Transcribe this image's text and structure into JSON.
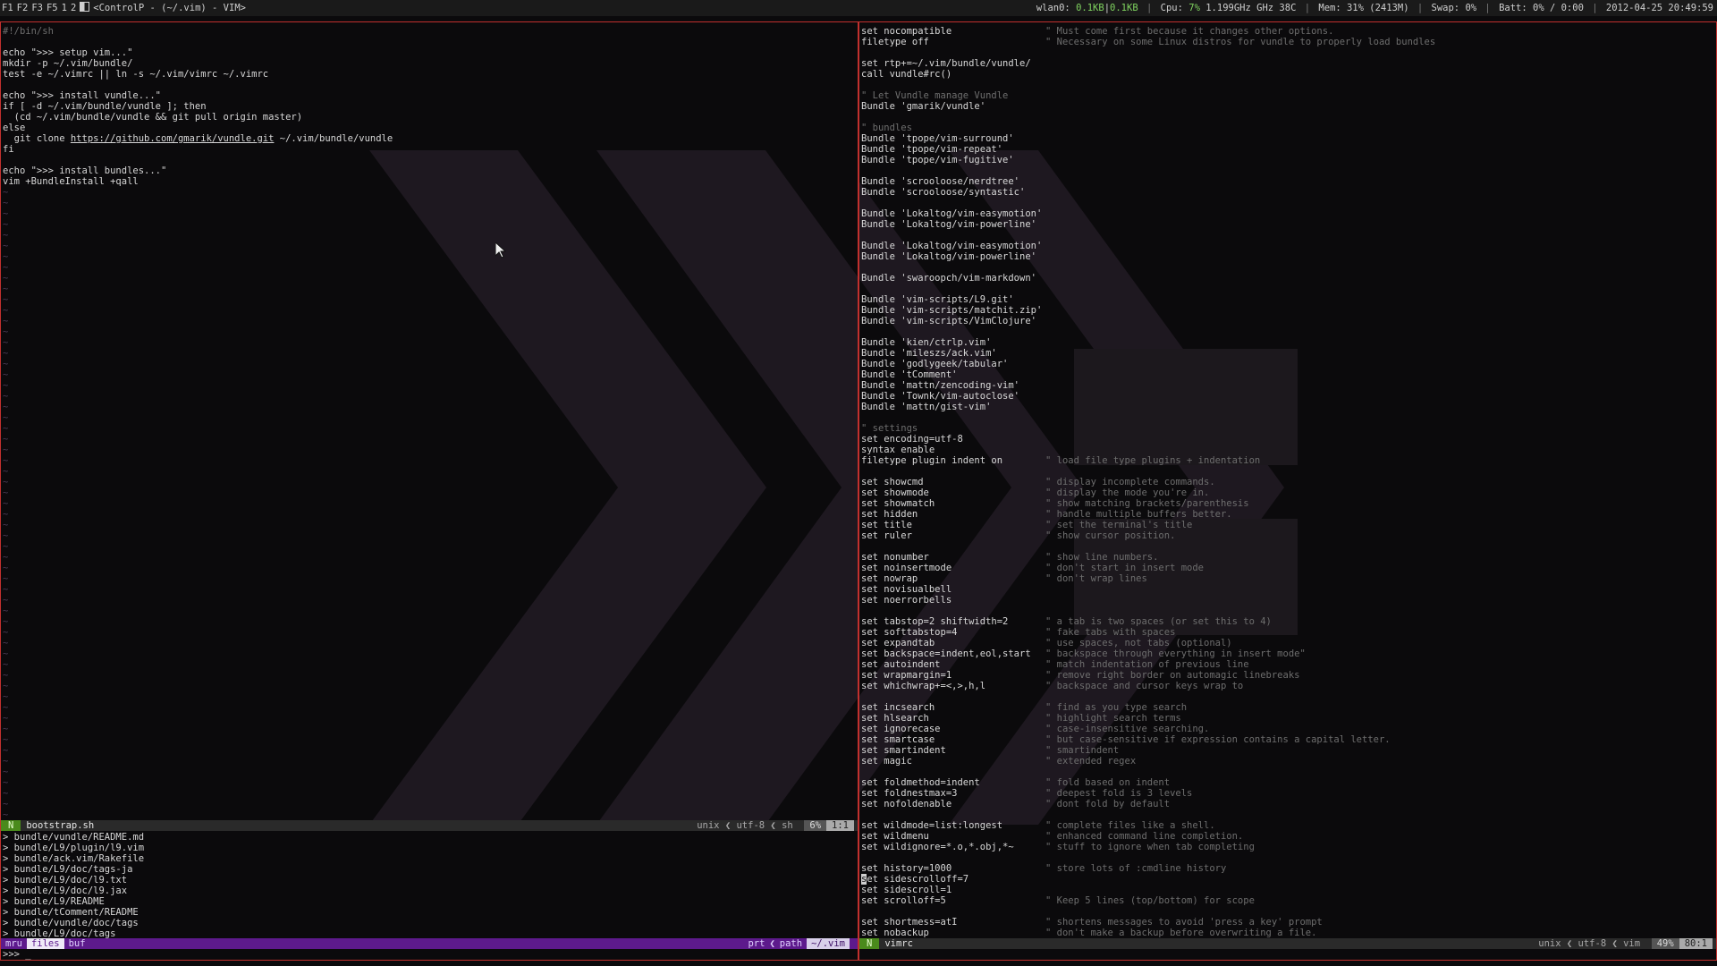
{
  "topbar": {
    "tags": [
      "F1",
      "F2",
      "F3",
      "F5",
      "1",
      "2"
    ],
    "window_title": "<ControlP - (~/.vim) - VIM>",
    "net_label": "wlan0:",
    "net_down": "0.1KB",
    "net_sep": "|",
    "net_up": "0.1KB",
    "cpu_label": "Cpu:",
    "cpu_pct": "7%",
    "cpu_freq": "1.199GHz GHz",
    "cpu_temp": "38C",
    "mem": "Mem: 31% (2413M)",
    "swap": "Swap: 0%",
    "batt": "Batt: 0% / 0:00",
    "datetime": "2012-04-25 20:49:59"
  },
  "left_pane": {
    "lines": [
      {
        "t": "#!/bin/sh",
        "c": "cmt"
      },
      {
        "t": "",
        "c": ""
      },
      {
        "t": "echo \">>> setup vim...\"",
        "c": ""
      },
      {
        "t": "mkdir -p ~/.vim/bundle/",
        "c": ""
      },
      {
        "t": "test -e ~/.vimrc || ln -s ~/.vim/vimrc ~/.vimrc",
        "c": ""
      },
      {
        "t": "",
        "c": ""
      },
      {
        "t": "echo \">>> install vundle...\"",
        "c": ""
      },
      {
        "t": "if [ -d ~/.vim/bundle/vundle ]; then",
        "c": ""
      },
      {
        "t": "  (cd ~/.vim/bundle/vundle && git pull origin master)",
        "c": ""
      },
      {
        "t": "else",
        "c": ""
      },
      {
        "t": "  git clone ",
        "c": "",
        "url": "https://github.com/gmarik/vundle.git",
        "after": " ~/.vim/bundle/vundle"
      },
      {
        "t": "fi",
        "c": ""
      },
      {
        "t": "",
        "c": ""
      },
      {
        "t": "echo \">>> install bundles...\"",
        "c": ""
      },
      {
        "t": "vim +BundleInstall +qall",
        "c": ""
      }
    ],
    "tilde_count": 59,
    "status": {
      "mode": "N",
      "filename": "bootstrap.sh",
      "format": "unix",
      "encoding": "utf-8",
      "filetype": "sh",
      "percent": "6%",
      "position": "1:1"
    },
    "ctrlp_items": [
      "> bundle/vundle/README.md",
      "> bundle/L9/plugin/l9.vim",
      "> bundle/ack.vim/Rakefile",
      "> bundle/L9/doc/tags-ja",
      "> bundle/L9/doc/l9.txt",
      "> bundle/L9/doc/l9.jax",
      "> bundle/L9/README",
      "> bundle/tComment/README",
      "> bundle/vundle/doc/tags",
      "> bundle/L9/doc/tags"
    ],
    "ctrlp_status": {
      "mru": "mru",
      "files": "files",
      "buf": "buf",
      "prt": "prt",
      "path": "path",
      "cwd": "~/.vim"
    },
    "prompt": ">>> _"
  },
  "right_pane": {
    "lines": [
      {
        "code": "set nocompatible",
        "cmt": "\" Must come first because it changes other options."
      },
      {
        "code": "filetype off",
        "cmt": "\" Necessary on some Linux distros for vundle to properly load bundles"
      },
      {
        "code": "",
        "cmt": ""
      },
      {
        "code": "set rtp+=~/.vim/bundle/vundle/",
        "cmt": ""
      },
      {
        "code": "call vundle#rc()",
        "cmt": ""
      },
      {
        "code": "",
        "cmt": ""
      },
      {
        "code": "\" Let Vundle manage Vundle",
        "cmt": "",
        "allcmt": true
      },
      {
        "code": "Bundle 'gmarik/vundle'",
        "cmt": ""
      },
      {
        "code": "",
        "cmt": ""
      },
      {
        "code": "\" bundles",
        "cmt": "",
        "allcmt": true
      },
      {
        "code": "Bundle 'tpope/vim-surround'",
        "cmt": ""
      },
      {
        "code": "Bundle 'tpope/vim-repeat'",
        "cmt": ""
      },
      {
        "code": "Bundle 'tpope/vim-fugitive'",
        "cmt": ""
      },
      {
        "code": "",
        "cmt": ""
      },
      {
        "code": "Bundle 'scrooloose/nerdtree'",
        "cmt": ""
      },
      {
        "code": "Bundle 'scrooloose/syntastic'",
        "cmt": ""
      },
      {
        "code": "",
        "cmt": ""
      },
      {
        "code": "Bundle 'Lokaltog/vim-easymotion'",
        "cmt": ""
      },
      {
        "code": "Bundle 'Lokaltog/vim-powerline'",
        "cmt": ""
      },
      {
        "code": "",
        "cmt": ""
      },
      {
        "code": "Bundle 'Lokaltog/vim-easymotion'",
        "cmt": ""
      },
      {
        "code": "Bundle 'Lokaltog/vim-powerline'",
        "cmt": ""
      },
      {
        "code": "",
        "cmt": ""
      },
      {
        "code": "Bundle 'swaroopch/vim-markdown'",
        "cmt": ""
      },
      {
        "code": "",
        "cmt": ""
      },
      {
        "code": "Bundle 'vim-scripts/L9.git'",
        "cmt": ""
      },
      {
        "code": "Bundle 'vim-scripts/matchit.zip'",
        "cmt": ""
      },
      {
        "code": "Bundle 'vim-scripts/VimClojure'",
        "cmt": ""
      },
      {
        "code": "",
        "cmt": ""
      },
      {
        "code": "Bundle 'kien/ctrlp.vim'",
        "cmt": ""
      },
      {
        "code": "Bundle 'mileszs/ack.vim'",
        "cmt": ""
      },
      {
        "code": "Bundle 'godlygeek/tabular'",
        "cmt": ""
      },
      {
        "code": "Bundle 'tComment'",
        "cmt": ""
      },
      {
        "code": "Bundle 'mattn/zencoding-vim'",
        "cmt": ""
      },
      {
        "code": "Bundle 'Townk/vim-autoclose'",
        "cmt": ""
      },
      {
        "code": "Bundle 'mattn/gist-vim'",
        "cmt": ""
      },
      {
        "code": "",
        "cmt": ""
      },
      {
        "code": "\" settings",
        "cmt": "",
        "allcmt": true
      },
      {
        "code": "set encoding=utf-8",
        "cmt": ""
      },
      {
        "code": "syntax enable",
        "cmt": ""
      },
      {
        "code": "filetype plugin indent on",
        "cmt": "\" load file type plugins + indentation"
      },
      {
        "code": "",
        "cmt": ""
      },
      {
        "code": "set showcmd",
        "cmt": "\" display incomplete commands."
      },
      {
        "code": "set showmode",
        "cmt": "\" display the mode you're in."
      },
      {
        "code": "set showmatch",
        "cmt": "\" show matching brackets/parenthesis"
      },
      {
        "code": "set hidden",
        "cmt": "\" handle multiple buffers better."
      },
      {
        "code": "set title",
        "cmt": "\" set the terminal's title"
      },
      {
        "code": "set ruler",
        "cmt": "\" show cursor position."
      },
      {
        "code": "",
        "cmt": ""
      },
      {
        "code": "set nonumber",
        "cmt": "\" show line numbers."
      },
      {
        "code": "set noinsertmode",
        "cmt": "\" don't start in insert mode"
      },
      {
        "code": "set nowrap",
        "cmt": "\" don't wrap lines"
      },
      {
        "code": "set novisualbell",
        "cmt": ""
      },
      {
        "code": "set noerrorbells",
        "cmt": ""
      },
      {
        "code": "",
        "cmt": ""
      },
      {
        "code": "set tabstop=2 shiftwidth=2",
        "cmt": "\" a tab is two spaces (or set this to 4)"
      },
      {
        "code": "set softtabstop=4",
        "cmt": "\" fake tabs with spaces"
      },
      {
        "code": "set expandtab",
        "cmt": "\" use spaces, not tabs (optional)"
      },
      {
        "code": "set backspace=indent,eol,start",
        "cmt": "\" backspace through everything in insert mode\""
      },
      {
        "code": "set autoindent",
        "cmt": "\" match indentation of previous line"
      },
      {
        "code": "set wrapmargin=1",
        "cmt": "\" remove right border on automagic linebreaks"
      },
      {
        "code": "set whichwrap+=<,>,h,l",
        "cmt": "\" backspace and cursor keys wrap to"
      },
      {
        "code": "",
        "cmt": ""
      },
      {
        "code": "set incsearch",
        "cmt": "\" find as you type search"
      },
      {
        "code": "set hlsearch",
        "cmt": "\" highlight search terms"
      },
      {
        "code": "set ignorecase",
        "cmt": "\" case-insensitive searching."
      },
      {
        "code": "set smartcase",
        "cmt": "\" but case-sensitive if expression contains a capital letter."
      },
      {
        "code": "set smartindent",
        "cmt": "\" smartindent"
      },
      {
        "code": "set magic",
        "cmt": "\" extended regex"
      },
      {
        "code": "",
        "cmt": ""
      },
      {
        "code": "set foldmethod=indent",
        "cmt": "\" fold based on indent"
      },
      {
        "code": "set foldnestmax=3",
        "cmt": "\" deepest fold is 3 levels"
      },
      {
        "code": "set nofoldenable",
        "cmt": "\" dont fold by default"
      },
      {
        "code": "",
        "cmt": ""
      },
      {
        "code": "set wildmode=list:longest",
        "cmt": "\" complete files like a shell."
      },
      {
        "code": "set wildmenu",
        "cmt": "\" enhanced command line completion."
      },
      {
        "code": "set wildignore=*.o,*.obj,*~",
        "cmt": "\" stuff to ignore when tab completing"
      },
      {
        "code": "",
        "cmt": ""
      },
      {
        "code": "set history=1000",
        "cmt": "\" store lots of :cmdline history"
      },
      {
        "code": "set sidescrolloff=7",
        "cmt": "",
        "cursor": true
      },
      {
        "code": "set sidescroll=1",
        "cmt": ""
      },
      {
        "code": "set scrolloff=5",
        "cmt": "\" Keep 5 lines (top/bottom) for scope"
      },
      {
        "code": "",
        "cmt": ""
      },
      {
        "code": "set shortmess=atI",
        "cmt": "\" shortens messages to avoid 'press a key' prompt"
      },
      {
        "code": "set nobackup",
        "cmt": "\" don't make a backup before overwriting a file."
      }
    ],
    "status": {
      "mode": "N",
      "filename": "vimrc",
      "format": "unix",
      "encoding": "utf-8",
      "filetype": "vim",
      "percent": "49%",
      "position": "80:1"
    }
  }
}
